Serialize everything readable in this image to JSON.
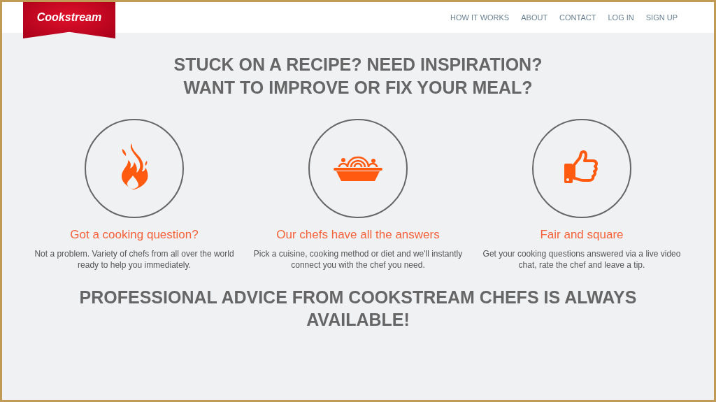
{
  "header": {
    "logo": "Cookstream",
    "nav": [
      {
        "label": "HOW IT WORKS"
      },
      {
        "label": "ABOUT"
      },
      {
        "label": "CONTACT"
      },
      {
        "label": "LOG IN"
      },
      {
        "label": "SIGN UP"
      }
    ]
  },
  "hero": {
    "lines": [
      "STUCK ON A RECIPE? NEED INSPIRATION?",
      "WANT TO IMPROVE OR FIX YOUR MEAL?"
    ]
  },
  "features": [
    {
      "title": "Got a cooking question?",
      "text": "Not a problem. Variety of chefs from all over the world ready to help you immediately."
    },
    {
      "title": "Our chefs have all the answers",
      "text": "Pick a cuisine, cooking method or diet and we'll instantly connect you with the chef you need."
    },
    {
      "title": "Fair and square",
      "text": "Get your cooking questions answered via a live video chat, rate the chef and leave a tip."
    }
  ],
  "closing": "PROFESSIONAL ADVICE FROM COOKSTREAM CHEFS IS ALWAYS AVAILABLE!"
}
